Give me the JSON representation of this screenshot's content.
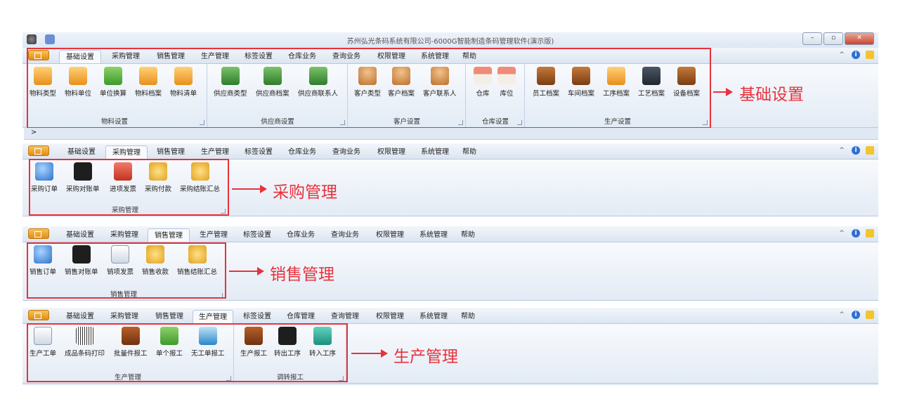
{
  "window": {
    "title": "苏州弘光条码系统有限公司-6000G智能制造条码管理软件(演示版)",
    "buttons": [
      "–",
      "▫",
      "✕"
    ]
  },
  "tabs": [
    "基础设置",
    "采购管理",
    "销售管理",
    "生产管理",
    "标签设置",
    "仓库业务",
    "查询业务",
    "权限管理",
    "系统管理",
    "帮助"
  ],
  "tabs_production_panel": [
    "基础设置",
    "采购管理",
    "销售管理",
    "生产管理",
    "标签设置",
    "仓库管理",
    "查询管理",
    "权限管理",
    "系统管理",
    "帮助"
  ],
  "panels": {
    "basic": {
      "active_tab": "基础设置",
      "groups": [
        {
          "label": "物料设置",
          "items": [
            "物料类型",
            "物料单位",
            "单位换算",
            "物料档案",
            "物料清单"
          ]
        },
        {
          "label": "供应商设置",
          "items": [
            "供应商类型",
            "供应商档案",
            "供应商联系人"
          ]
        },
        {
          "label": "客户设置",
          "items": [
            "客户类型",
            "客户档案",
            "客户联系人"
          ]
        },
        {
          "label": "仓库设置",
          "items": [
            "仓库",
            "库位"
          ]
        },
        {
          "label": "生产设置",
          "items": [
            "员工档案",
            "车间档案",
            "工序档案",
            "工艺档案",
            "设备档案"
          ]
        }
      ],
      "annotation": "基础设置"
    },
    "purchase": {
      "active_tab": "采购管理",
      "groups": [
        {
          "label": "采购管理",
          "items": [
            "采购订单",
            "采购对账单",
            "进项发票",
            "采购付款",
            "采购结账汇总"
          ]
        }
      ],
      "annotation": "采购管理"
    },
    "sales": {
      "active_tab": "销售管理",
      "groups": [
        {
          "label": "销售管理",
          "items": [
            "销售订单",
            "销售对账单",
            "销项发票",
            "销售收款",
            "销售结账汇总"
          ]
        }
      ],
      "annotation": "销售管理"
    },
    "production": {
      "active_tab": "生产管理",
      "groups": [
        {
          "label": "生产管理",
          "items": [
            "生产工单",
            "成品条码打印",
            "批量件报工",
            "单个报工",
            "无工单报工"
          ]
        },
        {
          "label": "调转报工",
          "items": [
            "生产报工",
            "转出工序",
            "转入工序"
          ]
        }
      ],
      "annotation": "生产管理"
    }
  },
  "collapse_glyph": ">",
  "colors": {
    "annotation_red": "#e8323c",
    "ribbon_bg": "#dfe8f3",
    "tab_active": "#f7f9fc"
  }
}
